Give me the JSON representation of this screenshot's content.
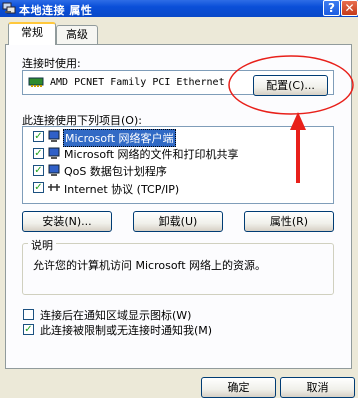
{
  "window": {
    "title": "本地连接 属性",
    "help_label": "?",
    "close_label": "✕"
  },
  "tabs": [
    {
      "label": "常规"
    },
    {
      "label": "高级"
    }
  ],
  "connect_using": {
    "label": "连接时使用:",
    "adapter_name": "AMD PCNET Family PCI Ethernet",
    "configure_label": "配置(C)..."
  },
  "components": {
    "label": "此连接使用下列项目(O):",
    "items": [
      {
        "label": "Microsoft 网络客户端",
        "checked": true,
        "selected": true,
        "icon": "network-client-icon"
      },
      {
        "label": "Microsoft 网络的文件和打印机共享",
        "checked": true,
        "selected": false,
        "icon": "file-printer-sharing-icon"
      },
      {
        "label": "QoS 数据包计划程序",
        "checked": true,
        "selected": false,
        "icon": "qos-scheduler-icon"
      },
      {
        "label": "Internet 协议 (TCP/IP)",
        "checked": true,
        "selected": false,
        "icon": "protocol-icon"
      }
    ],
    "install_label": "安装(N)...",
    "uninstall_label": "卸载(U)",
    "properties_label": "属性(R)"
  },
  "description": {
    "title": "说明",
    "text": "允许您的计算机访问 Microsoft 网络上的资源。"
  },
  "options": [
    {
      "label": "连接后在通知区域显示图标(W)",
      "checked": false
    },
    {
      "label": "此连接被限制或无连接时通知我(M)",
      "checked": true
    }
  ],
  "footer": {
    "ok_label": "确定",
    "cancel_label": "取消"
  },
  "annotation": {
    "color": "#E8201A"
  }
}
